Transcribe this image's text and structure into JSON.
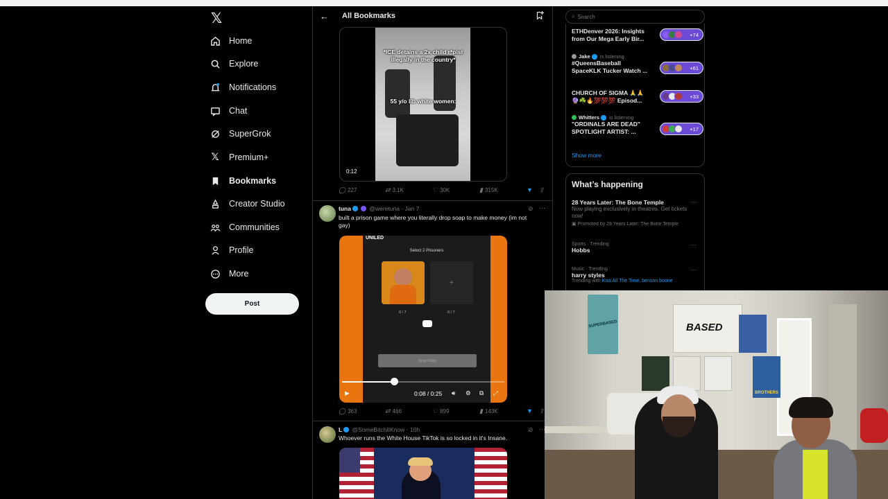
{
  "nav": {
    "items": [
      {
        "label": "Home",
        "icon": "home-icon"
      },
      {
        "label": "Explore",
        "icon": "search-icon"
      },
      {
        "label": "Notifications",
        "icon": "bell-icon"
      },
      {
        "label": "Chat",
        "icon": "chat-icon"
      },
      {
        "label": "SuperGrok",
        "icon": "grok-icon"
      },
      {
        "label": "Premium+",
        "icon": "x-icon"
      },
      {
        "label": "Bookmarks",
        "icon": "bookmark-icon"
      },
      {
        "label": "Creator Studio",
        "icon": "creator-icon"
      },
      {
        "label": "Communities",
        "icon": "communities-icon"
      },
      {
        "label": "Profile",
        "icon": "profile-icon"
      },
      {
        "label": "More",
        "icon": "more-icon"
      }
    ],
    "post_label": "Post"
  },
  "header": {
    "title": "All Bookmarks"
  },
  "tweet1": {
    "caption_top": "*ICE detains a 2x child r*pist illegally in the country*",
    "caption_mid": "55 y/o lib white women:",
    "duration": "0:12",
    "replies": "227",
    "reposts": "3.1K",
    "likes": "30K",
    "views": "315K"
  },
  "tweet2": {
    "name": "tuna",
    "handle": "@weretuna",
    "date": "Jan 7",
    "text": "built a prison game where you literally drop soap to make money (im not gay)",
    "game_brand": "UNILED",
    "game_select": "Select 2 Prisoners",
    "count1": "0 / 7",
    "count2": "0 / 7",
    "drop_label": "Drop Soap",
    "time": "0:08 / 0:25",
    "progress": 0.32,
    "replies": "363",
    "reposts": "466",
    "likes": "899",
    "views": "143K"
  },
  "tweet3": {
    "name": "L",
    "handle": "@SomeBitchIIKnow",
    "date": "10h",
    "text": "Whoever runs the White House TikTok is so locked in it's Insane."
  },
  "search": {
    "placeholder": "Search"
  },
  "spaces": {
    "items": [
      {
        "host": "",
        "title": "ETHDenver 2026: Insights from Our Mega Early Bir...",
        "count": "+74"
      },
      {
        "host": "Jake",
        "status": "is listening",
        "title": "#QueensBaseball SpaceKLK Tucker Watch ...",
        "count": "+61"
      },
      {
        "host": "",
        "title": "CHURCH OF SIGMA 🙏🙏 🔮☘️🔥💯💯💯 Episod...",
        "count": "+33"
      },
      {
        "host": "Whitters",
        "status": "is listening",
        "title": "\"ORDINALS ARE DEAD\" SPOTLIGHT ARTIST: ...",
        "count": "+17"
      }
    ],
    "show_more": "Show more"
  },
  "happening": {
    "title": "What’s happening",
    "trends": [
      {
        "meta": "",
        "title": "28 Years Later: The Bone Temple",
        "desc": "Now playing exclusively in theatres. Get tickets now!",
        "promo": "Promoted by 28 Years Later: The Bone Temple"
      },
      {
        "meta": "Sports · Trending",
        "title": "Hobbs"
      },
      {
        "meta": "Music · Trending",
        "title": "harry styles",
        "trending_with": "Trending with",
        "links": "Kiss All The Time, benson boone"
      }
    ]
  },
  "webcam": {
    "based_sign": "BASED",
    "flag_text": "SUPERBASED",
    "poster_text": "BROTHERS"
  },
  "colors": {
    "accent": "#1d9bf0",
    "background": "#000000",
    "border": "#2f3336",
    "game_orange": "#e8750f"
  }
}
